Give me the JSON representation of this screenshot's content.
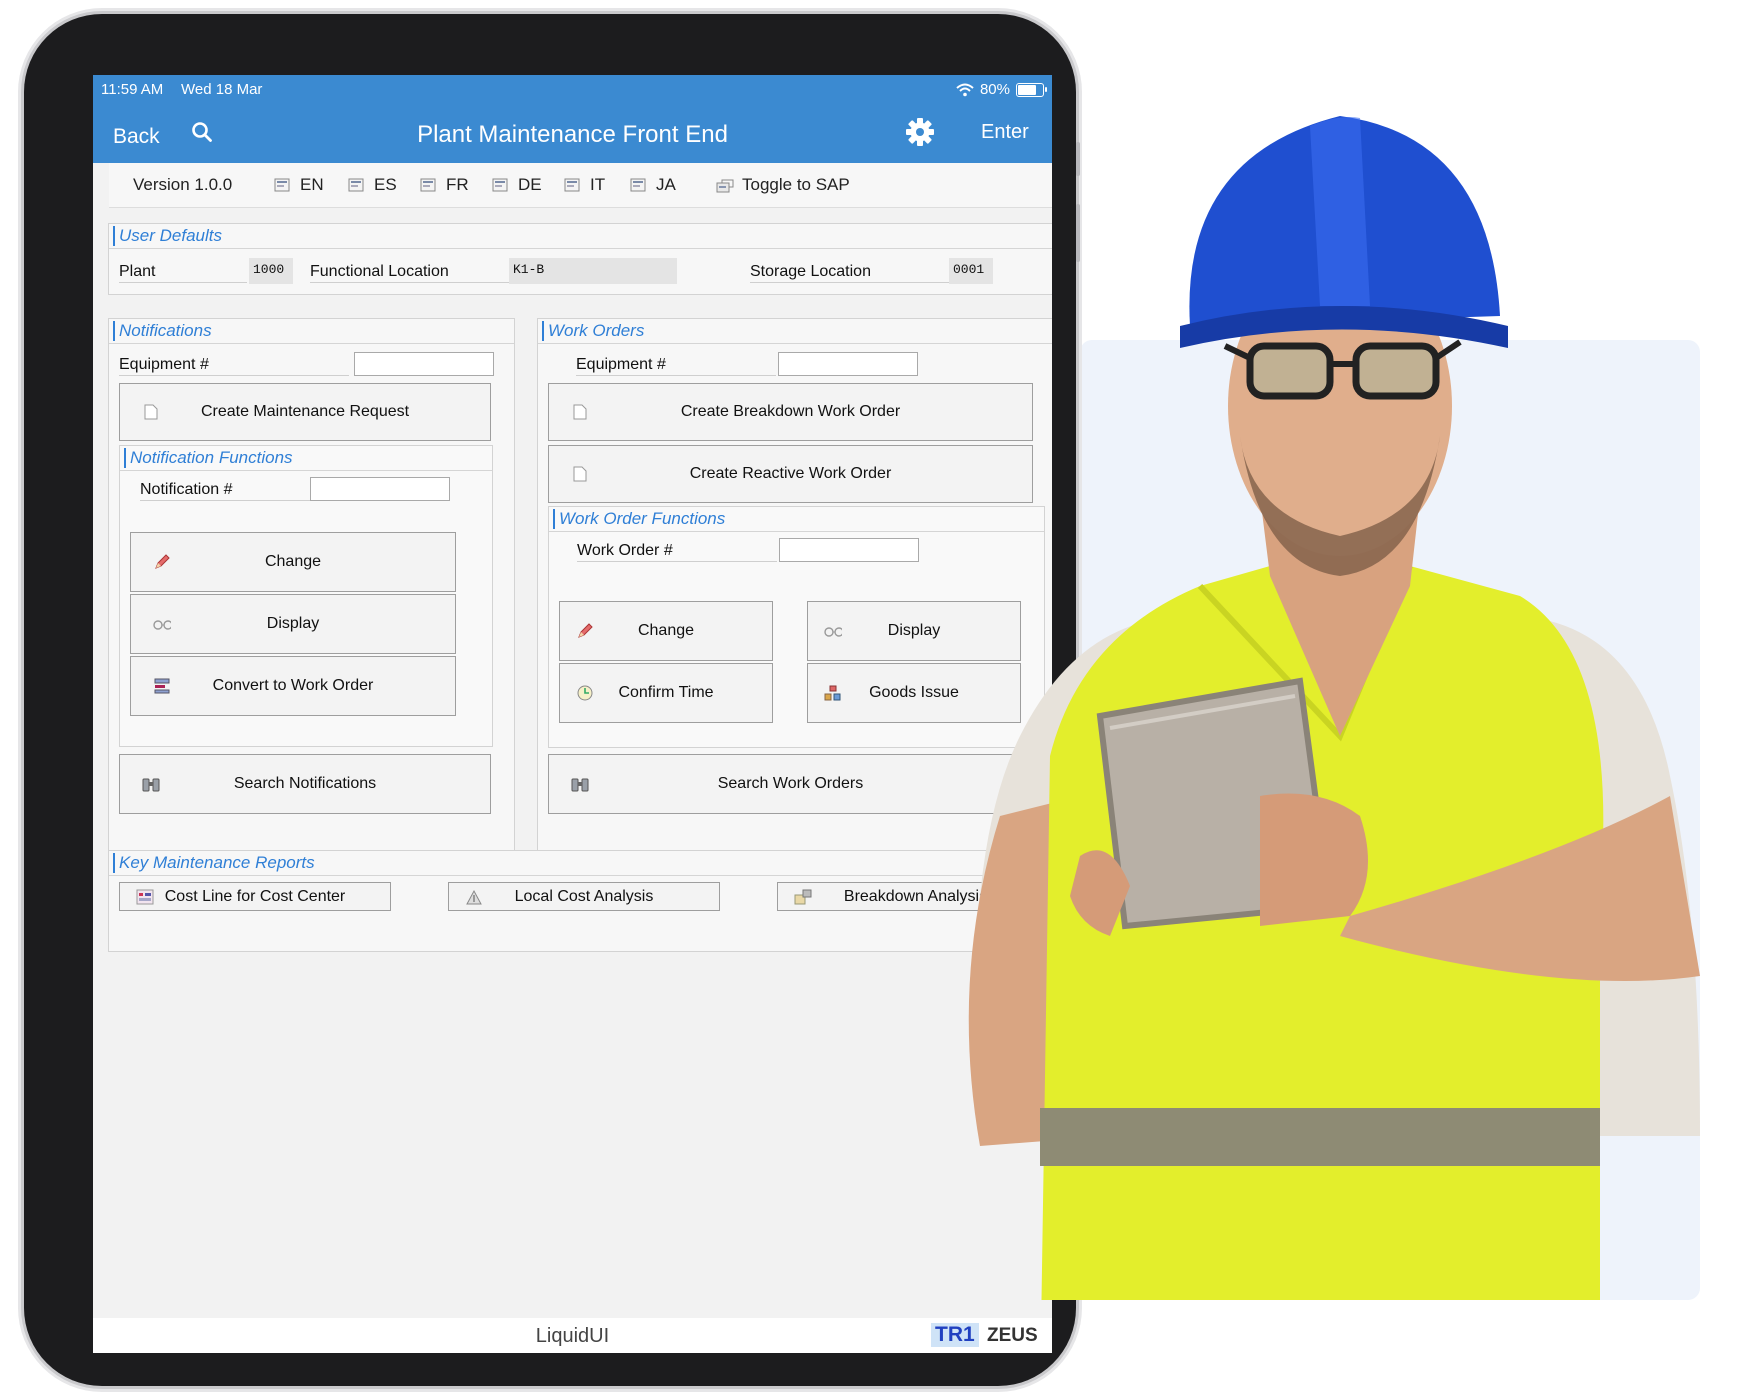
{
  "status_bar": {
    "time": "11:59 AM",
    "date": "Wed 18 Mar",
    "battery": "80%",
    "battery_level": 0.8
  },
  "nav": {
    "back": "Back",
    "title": "Plant Maintenance Front End",
    "enter": "Enter"
  },
  "toolbar": {
    "version": "Version 1.0.0",
    "languages": [
      "EN",
      "ES",
      "FR",
      "DE",
      "IT",
      "JA"
    ],
    "toggle": "Toggle to SAP"
  },
  "user_defaults": {
    "title": "User Defaults",
    "plant_label": "Plant",
    "plant_value": "1000",
    "floc_label": "Functional Location",
    "floc_value": "K1-B",
    "sloc_label": "Storage Location",
    "sloc_value": "0001"
  },
  "notifications": {
    "title": "Notifications",
    "equipment_label": "Equipment #",
    "create_button": "Create Maintenance Request",
    "functions_title": "Notification Functions",
    "notification_label": "Notification #",
    "change": "Change",
    "display": "Display",
    "convert": "Convert to Work Order",
    "search": "Search Notifications"
  },
  "work_orders": {
    "title": "Work Orders",
    "equipment_label": "Equipment #",
    "create_breakdown": "Create Breakdown Work Order",
    "create_reactive": "Create Reactive Work Order",
    "functions_title": "Work Order Functions",
    "work_order_label": "Work Order #",
    "change": "Change",
    "display": "Display",
    "confirm_time": "Confirm Time",
    "goods_issue": "Goods Issue",
    "search": "Search Work Orders"
  },
  "reports": {
    "title": "Key Maintenance Reports",
    "cost_line": "Cost Line for Cost Center",
    "local_cost": "Local Cost Analysis",
    "breakdown": "Breakdown Analysis"
  },
  "footer": {
    "brand": "LiquidUI",
    "system": "TR1",
    "host": "ZEUS"
  },
  "colors": {
    "accent": "#3b8ad1",
    "group_title": "#2f7fd6",
    "vest": "#e3ee2c",
    "helmet": "#1f4fd0"
  }
}
